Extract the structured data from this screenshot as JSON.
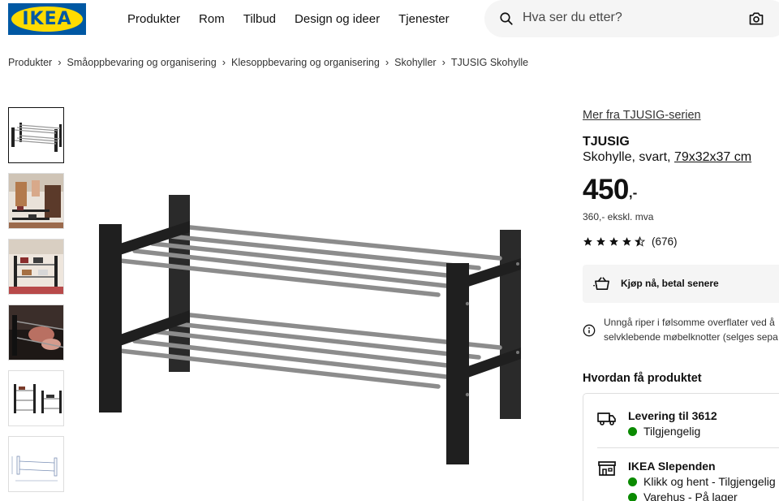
{
  "header": {
    "logo_text": "IKEA",
    "nav": [
      "Produkter",
      "Rom",
      "Tilbud",
      "Design og ideer",
      "Tjenester"
    ],
    "search_placeholder": "Hva ser du etter?"
  },
  "breadcrumb": [
    "Produkter",
    "Småoppbevaring og organisering",
    "Klesoppbevaring og organisering",
    "Skohyller",
    "TJUSIG Skohylle"
  ],
  "gallery": {
    "thumbnail_count": 6,
    "selected_index": 0
  },
  "product": {
    "series_link": "Mer fra TJUSIG-serien",
    "name": "TJUSIG",
    "description": "Skohylle, svart, ",
    "dimensions": "79x32x37 cm",
    "price": "450",
    "price_suffix": ",-",
    "price_excl_vat": "360,- ekskl. mva",
    "rating_stars": 4.5,
    "review_count": "(676)",
    "buy_now_label": "Kjøp nå, betal senere",
    "info_line1": "Unngå riper i følsomme overflater ved å",
    "info_line2": "selvklebende møbelknotter (selges sepa"
  },
  "availability": {
    "title": "Hvordan få produktet",
    "delivery_title": "Levering til 3612",
    "delivery_status": "Tilgjengelig",
    "store_title": "IKEA Slependen",
    "store_status_1": "Klikk og hent - Tilgjengelig",
    "store_status_2": "Varehus - På lager"
  },
  "colors": {
    "ikea_blue": "#0058a3",
    "ikea_yellow": "#ffdb00",
    "available_green": "#0a8a00"
  }
}
